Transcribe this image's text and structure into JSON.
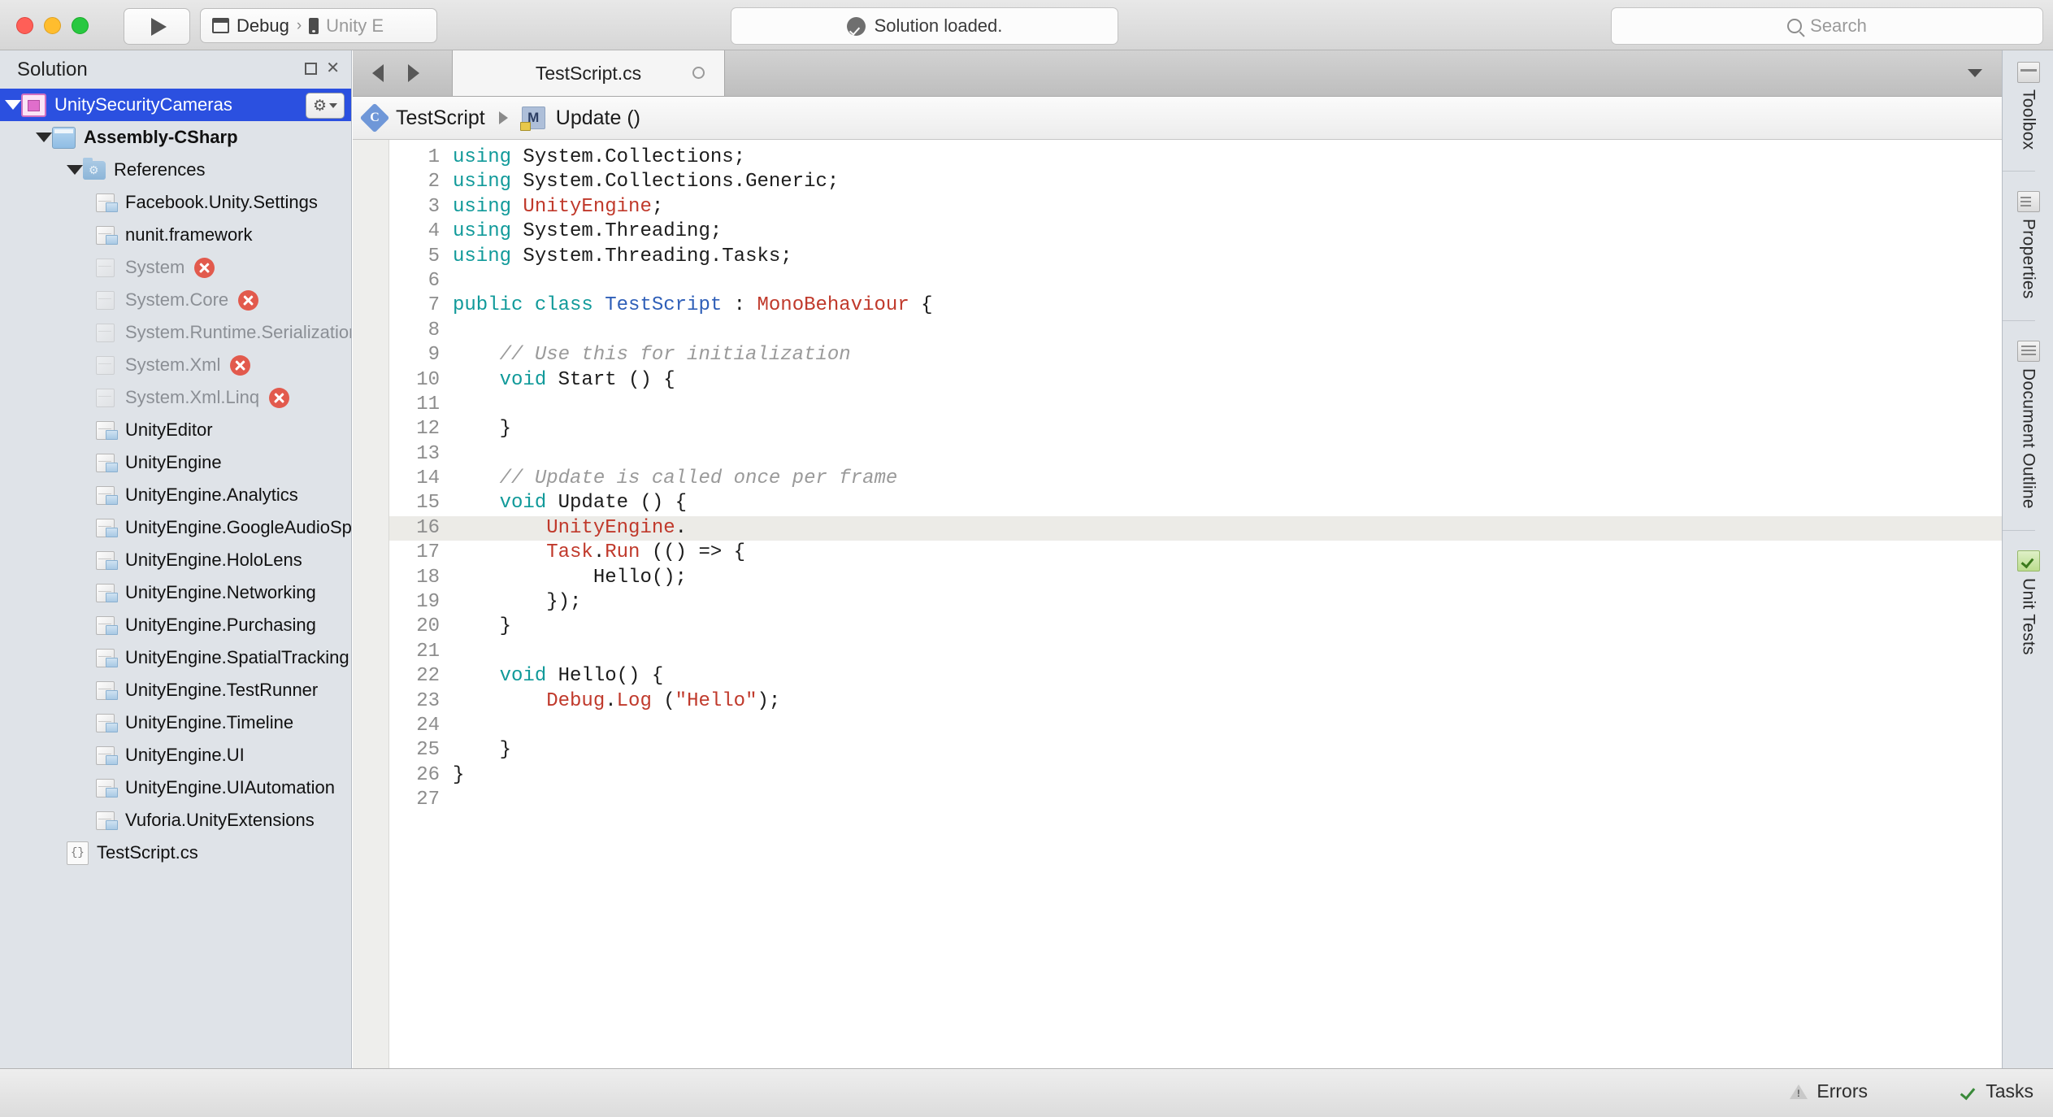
{
  "titlebar": {
    "run_button_icon": "play-icon",
    "config": {
      "window_icon": "window-icon",
      "configuration": "Debug",
      "separator": "›",
      "device_icon": "device-icon",
      "target": "Unity E"
    },
    "status": {
      "icon": "check-circle-icon",
      "text": "Solution loaded."
    },
    "search": {
      "icon": "search-icon",
      "placeholder": "Search"
    }
  },
  "solution_pad": {
    "title": "Solution",
    "header_buttons": [
      "restore-icon",
      "close-icon"
    ],
    "gear_button": "gear-dropdown-button",
    "tree": [
      {
        "label": "UnitySecurityCameras",
        "indent": 0,
        "icon": "solution-icon",
        "expander": "expanded",
        "selected": true,
        "bold": false,
        "dim": false,
        "error": false
      },
      {
        "label": "Assembly-CSharp",
        "indent": 1,
        "icon": "project-icon",
        "expander": "expanded",
        "selected": false,
        "bold": true,
        "dim": false,
        "error": false
      },
      {
        "label": "References",
        "indent": 2,
        "icon": "references-folder-icon",
        "expander": "expanded",
        "selected": false,
        "bold": false,
        "dim": false,
        "error": false
      },
      {
        "label": "Facebook.Unity.Settings",
        "indent": 3,
        "icon": "assembly-icon",
        "expander": "none",
        "selected": false,
        "bold": false,
        "dim": false,
        "error": false
      },
      {
        "label": "nunit.framework",
        "indent": 3,
        "icon": "assembly-icon",
        "expander": "none",
        "selected": false,
        "bold": false,
        "dim": false,
        "error": false
      },
      {
        "label": "System",
        "indent": 3,
        "icon": "assembly-icon",
        "expander": "none",
        "selected": false,
        "bold": false,
        "dim": true,
        "error": true
      },
      {
        "label": "System.Core",
        "indent": 3,
        "icon": "assembly-icon",
        "expander": "none",
        "selected": false,
        "bold": false,
        "dim": true,
        "error": true
      },
      {
        "label": "System.Runtime.Serialization",
        "indent": 3,
        "icon": "assembly-icon",
        "expander": "none",
        "selected": false,
        "bold": false,
        "dim": true,
        "error": false
      },
      {
        "label": "System.Xml",
        "indent": 3,
        "icon": "assembly-icon",
        "expander": "none",
        "selected": false,
        "bold": false,
        "dim": true,
        "error": true
      },
      {
        "label": "System.Xml.Linq",
        "indent": 3,
        "icon": "assembly-icon",
        "expander": "none",
        "selected": false,
        "bold": false,
        "dim": true,
        "error": true
      },
      {
        "label": "UnityEditor",
        "indent": 3,
        "icon": "assembly-icon",
        "expander": "none",
        "selected": false,
        "bold": false,
        "dim": false,
        "error": false
      },
      {
        "label": "UnityEngine",
        "indent": 3,
        "icon": "assembly-icon",
        "expander": "none",
        "selected": false,
        "bold": false,
        "dim": false,
        "error": false
      },
      {
        "label": "UnityEngine.Analytics",
        "indent": 3,
        "icon": "assembly-icon",
        "expander": "none",
        "selected": false,
        "bold": false,
        "dim": false,
        "error": false
      },
      {
        "label": "UnityEngine.GoogleAudioSpat",
        "indent": 3,
        "icon": "assembly-icon",
        "expander": "none",
        "selected": false,
        "bold": false,
        "dim": false,
        "error": false
      },
      {
        "label": "UnityEngine.HoloLens",
        "indent": 3,
        "icon": "assembly-icon",
        "expander": "none",
        "selected": false,
        "bold": false,
        "dim": false,
        "error": false
      },
      {
        "label": "UnityEngine.Networking",
        "indent": 3,
        "icon": "assembly-icon",
        "expander": "none",
        "selected": false,
        "bold": false,
        "dim": false,
        "error": false
      },
      {
        "label": "UnityEngine.Purchasing",
        "indent": 3,
        "icon": "assembly-icon",
        "expander": "none",
        "selected": false,
        "bold": false,
        "dim": false,
        "error": false
      },
      {
        "label": "UnityEngine.SpatialTracking",
        "indent": 3,
        "icon": "assembly-icon",
        "expander": "none",
        "selected": false,
        "bold": false,
        "dim": false,
        "error": false
      },
      {
        "label": "UnityEngine.TestRunner",
        "indent": 3,
        "icon": "assembly-icon",
        "expander": "none",
        "selected": false,
        "bold": false,
        "dim": false,
        "error": false
      },
      {
        "label": "UnityEngine.Timeline",
        "indent": 3,
        "icon": "assembly-icon",
        "expander": "none",
        "selected": false,
        "bold": false,
        "dim": false,
        "error": false
      },
      {
        "label": "UnityEngine.UI",
        "indent": 3,
        "icon": "assembly-icon",
        "expander": "none",
        "selected": false,
        "bold": false,
        "dim": false,
        "error": false
      },
      {
        "label": "UnityEngine.UIAutomation",
        "indent": 3,
        "icon": "assembly-icon",
        "expander": "none",
        "selected": false,
        "bold": false,
        "dim": false,
        "error": false
      },
      {
        "label": "Vuforia.UnityExtensions",
        "indent": 3,
        "icon": "assembly-icon",
        "expander": "none",
        "selected": false,
        "bold": false,
        "dim": false,
        "error": false
      },
      {
        "label": "TestScript.cs",
        "indent": 2,
        "icon": "csharp-file-icon",
        "expander": "none",
        "selected": false,
        "bold": false,
        "dim": false,
        "error": false
      }
    ]
  },
  "editor": {
    "tab": {
      "label": "TestScript.cs",
      "dirty_indicator": "unsaved-dot-icon"
    },
    "nav": {
      "back": "back-arrow-icon",
      "forward": "forward-arrow-icon",
      "tab_list": "chevron-down-icon"
    },
    "breadcrumb": {
      "class_icon": "class-icon",
      "class_glyph": "C",
      "class_name": "TestScript",
      "separator": "▸",
      "method_icon": "method-icon",
      "method_glyph": "M",
      "method_name": "Update ()"
    },
    "current_line": 16,
    "lines": [
      {
        "n": 1,
        "tokens": [
          {
            "t": "using",
            "c": "k"
          },
          {
            "t": " System.Collections;",
            "c": "pln"
          }
        ]
      },
      {
        "n": 2,
        "tokens": [
          {
            "t": "using",
            "c": "k"
          },
          {
            "t": " System.Collections.Generic;",
            "c": "pln"
          }
        ]
      },
      {
        "n": 3,
        "tokens": [
          {
            "t": "using",
            "c": "k"
          },
          {
            "t": " ",
            "c": "pln"
          },
          {
            "t": "UnityEngine",
            "c": "typ"
          },
          {
            "t": ";",
            "c": "pln"
          }
        ]
      },
      {
        "n": 4,
        "tokens": [
          {
            "t": "using",
            "c": "k"
          },
          {
            "t": " System.Threading;",
            "c": "pln"
          }
        ]
      },
      {
        "n": 5,
        "tokens": [
          {
            "t": "using",
            "c": "k"
          },
          {
            "t": " System.Threading.Tasks;",
            "c": "pln"
          }
        ]
      },
      {
        "n": 6,
        "tokens": []
      },
      {
        "n": 7,
        "tokens": [
          {
            "t": "public class",
            "c": "k"
          },
          {
            "t": " ",
            "c": "pln"
          },
          {
            "t": "TestScript",
            "c": "cls"
          },
          {
            "t": " : ",
            "c": "pln"
          },
          {
            "t": "MonoBehaviour",
            "c": "typ"
          },
          {
            "t": " {",
            "c": "pln"
          }
        ]
      },
      {
        "n": 8,
        "tokens": []
      },
      {
        "n": 9,
        "tokens": [
          {
            "t": "    // Use this for initialization",
            "c": "cmt"
          }
        ]
      },
      {
        "n": 10,
        "tokens": [
          {
            "t": "    ",
            "c": "pln"
          },
          {
            "t": "void",
            "c": "k"
          },
          {
            "t": " Start () {",
            "c": "pln"
          }
        ]
      },
      {
        "n": 11,
        "tokens": []
      },
      {
        "n": 12,
        "tokens": [
          {
            "t": "    }",
            "c": "pln"
          }
        ]
      },
      {
        "n": 13,
        "tokens": []
      },
      {
        "n": 14,
        "tokens": [
          {
            "t": "    // Update is called once per frame",
            "c": "cmt"
          }
        ]
      },
      {
        "n": 15,
        "tokens": [
          {
            "t": "    ",
            "c": "pln"
          },
          {
            "t": "void",
            "c": "k"
          },
          {
            "t": " Update () {",
            "c": "pln"
          }
        ]
      },
      {
        "n": 16,
        "tokens": [
          {
            "t": "        ",
            "c": "pln"
          },
          {
            "t": "UnityEngine",
            "c": "typ"
          },
          {
            "t": ".",
            "c": "pln"
          }
        ]
      },
      {
        "n": 17,
        "tokens": [
          {
            "t": "        ",
            "c": "pln"
          },
          {
            "t": "Task",
            "c": "typ"
          },
          {
            "t": ".",
            "c": "pln"
          },
          {
            "t": "Run",
            "c": "typ"
          },
          {
            "t": " (() => {",
            "c": "pln"
          }
        ]
      },
      {
        "n": 18,
        "tokens": [
          {
            "t": "            Hello();",
            "c": "pln"
          }
        ]
      },
      {
        "n": 19,
        "tokens": [
          {
            "t": "        });",
            "c": "pln"
          }
        ]
      },
      {
        "n": 20,
        "tokens": [
          {
            "t": "    }",
            "c": "pln"
          }
        ]
      },
      {
        "n": 21,
        "tokens": []
      },
      {
        "n": 22,
        "tokens": [
          {
            "t": "    ",
            "c": "pln"
          },
          {
            "t": "void",
            "c": "k"
          },
          {
            "t": " Hello() {",
            "c": "pln"
          }
        ]
      },
      {
        "n": 23,
        "tokens": [
          {
            "t": "        ",
            "c": "pln"
          },
          {
            "t": "Debug",
            "c": "typ"
          },
          {
            "t": ".",
            "c": "pln"
          },
          {
            "t": "Log",
            "c": "typ"
          },
          {
            "t": " (",
            "c": "pln"
          },
          {
            "t": "\"Hello\"",
            "c": "str"
          },
          {
            "t": ");",
            "c": "pln"
          }
        ]
      },
      {
        "n": 24,
        "tokens": []
      },
      {
        "n": 25,
        "tokens": [
          {
            "t": "    }",
            "c": "pln"
          }
        ]
      },
      {
        "n": 26,
        "tokens": [
          {
            "t": "}",
            "c": "pln"
          }
        ]
      },
      {
        "n": 27,
        "tokens": []
      }
    ]
  },
  "right_pads": [
    {
      "label": "Toolbox",
      "icon": "toolbox-icon",
      "kind": "toolbox"
    },
    {
      "label": "Properties",
      "icon": "properties-icon",
      "kind": "props"
    },
    {
      "label": "Document Outline",
      "icon": "document-outline-icon",
      "kind": "doc"
    },
    {
      "label": "Unit Tests",
      "icon": "unit-tests-icon",
      "kind": "unit"
    }
  ],
  "bottom_bar": {
    "errors": {
      "icon": "warning-triangle-icon",
      "label": "Errors"
    },
    "tasks": {
      "icon": "check-icon",
      "label": "Tasks"
    }
  },
  "colors": {
    "accent_selection": "#2b50e0",
    "keyword": "#119a9a",
    "type": "#c0392b",
    "class_name": "#2f5fb8",
    "comment": "#9a9a9a",
    "error_badge": "#e25a4d"
  }
}
